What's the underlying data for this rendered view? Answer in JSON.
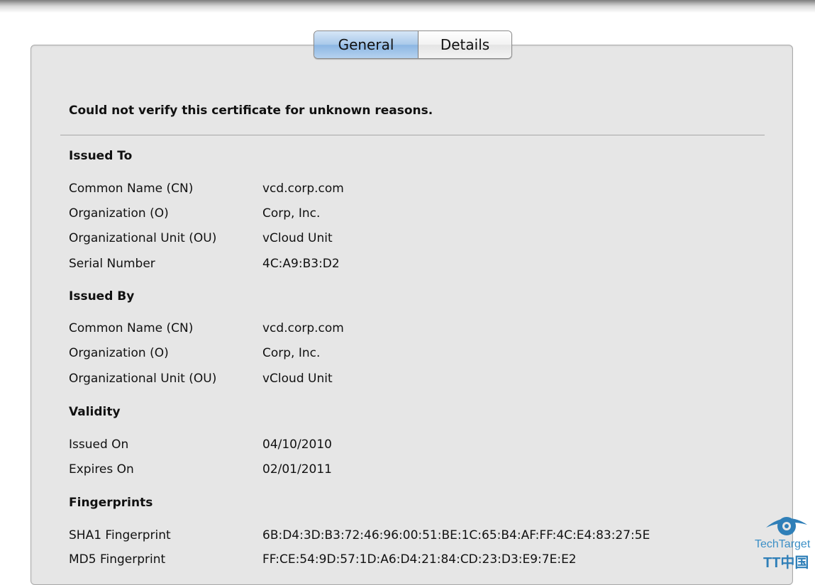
{
  "tabs": {
    "general": "General",
    "details": "Details",
    "active": "General"
  },
  "status_message": "Could not verify this certificate for unknown reasons.",
  "issued_to": {
    "heading": "Issued To",
    "rows": [
      {
        "label": "Common Name (CN)",
        "value": "vcd.corp.com"
      },
      {
        "label": "Organization (O)",
        "value": "Corp, Inc."
      },
      {
        "label": "Organizational Unit (OU)",
        "value": "vCloud Unit"
      },
      {
        "label": "Serial Number",
        "value": "4C:A9:B3:D2"
      }
    ]
  },
  "issued_by": {
    "heading": "Issued By",
    "rows": [
      {
        "label": "Common Name (CN)",
        "value": "vcd.corp.com"
      },
      {
        "label": "Organization (O)",
        "value": "Corp, Inc."
      },
      {
        "label": "Organizational Unit (OU)",
        "value": "vCloud Unit"
      }
    ]
  },
  "validity": {
    "heading": "Validity",
    "rows": [
      {
        "label": "Issued On",
        "value": "04/10/2010"
      },
      {
        "label": "Expires On",
        "value": "02/01/2011"
      }
    ]
  },
  "fingerprints": {
    "heading": "Fingerprints",
    "rows": [
      {
        "label": "SHA1 Fingerprint",
        "value": "6B:D4:3D:B3:72:46:96:00:51:BE:1C:65:B4:AF:FF:4C:E4:83:27:5E"
      },
      {
        "label": "MD5 Fingerprint",
        "value": "FF:CE:54:9D:57:1D:A6:D4:21:84:CD:23:D3:E9:7E:E2"
      }
    ]
  },
  "watermark": {
    "brand": "TechTarget",
    "sub": "TT中国"
  },
  "colors": {
    "active_tab": "#a9c9ea",
    "panel_bg": "#e6e6e6",
    "logo_blue": "#2f7fb8"
  }
}
